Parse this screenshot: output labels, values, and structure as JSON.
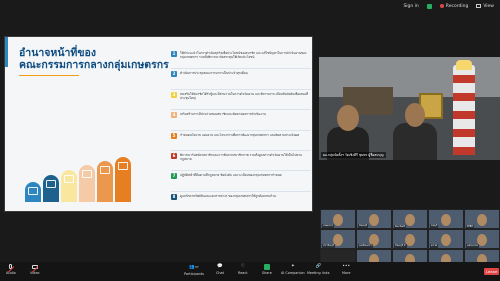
{
  "topbar": {
    "signin": "Sign in",
    "recording": "Recording",
    "view": "View"
  },
  "slide": {
    "title": "อำนาจหน้าที่ของ\nคณะกรรมการกลางกลุ่มเกษตรกร",
    "items": [
      {
        "num": "1",
        "color": "#2e86c1",
        "text": "ให้คำแนะนำในการดำเนินธุรกิจเพื่อประโยชน์ของสมาชิก และแก้ไขปัญหาในการดำเนินงานของกลุ่มเกษตรกร รวมทั้งพิจารณาจัดสรรทุนให้เกิดประโยชน์"
      },
      {
        "num": "2",
        "color": "#2e86c1",
        "text": "ดำเนินการประชุมคณะกรรมการเป็นประจำทุกเดือน"
      },
      {
        "num": "3",
        "color": "#f4d03f",
        "text": "ส่งเสริมให้สมาชิกได้รับรู้และมีส่วนร่วมในการดำเนินงาน และพิจารณาระเบียบข้อบังคับเพื่อเสนอที่ประชุมใหญ่"
      },
      {
        "num": "4",
        "color": "#f0b27a",
        "text": "เสริมสร้างการมีส่วนร่วมของสมาชิกและติดตามผลการดำเนินงาน"
      },
      {
        "num": "5",
        "color": "#e67e22",
        "text": "กำหนดนโยบาย แผนงาน และโครงการเพื่อการพัฒนากลุ่มเกษตรกร และติดตามประเมินผล"
      },
      {
        "num": "6",
        "color": "#c0392b",
        "text": "พิจารณารับสมัครสมาชิกและการพ้นจากสมาชิกภาพ รวมทั้งดูแลการดำเนินงานให้เป็นไปตามกฎหมาย"
      },
      {
        "num": "7",
        "color": "#239b56",
        "text": "ปฏิบัติหน้าที่อื่นตามที่กฎหมาย ข้อบังคับ และระเบียบของกลุ่มเกษตรกรกำหนด"
      },
      {
        "num": "8",
        "color": "#1a5276",
        "text": "ดูแลรักษาทรัพย์สินและเอกสารต่างๆ ของกลุ่มเกษตรกรให้ถูกต้องครบถ้วน"
      }
    ],
    "bar_colors": [
      "#2e86c1",
      "#1f618d",
      "#f9e79f",
      "#f5cba7",
      "#eb984e",
      "#e67e22"
    ],
    "bar_levels": [
      0.45,
      0.6,
      0.72,
      0.82,
      0.92,
      1.0
    ]
  },
  "speaker": {
    "name": "ผอ.กลุ่มจัดตั้งฯ วัดเชิงคีรี ชุมพร ผู้ชื่อสมบุญ"
  },
  "gallery": {
    "label": "1 of 2",
    "tiles": [
      {
        "name": "เกษตรกร",
        "dark": false
      },
      {
        "name": "จันทบุรี",
        "dark": false
      },
      {
        "name": "Suchart",
        "dark": false
      },
      {
        "name": "ชลบุรี",
        "dark": false
      },
      {
        "name": "PHM",
        "dark": false
      },
      {
        "name": "ปราจีนบุรี",
        "dark": false
      },
      {
        "name": "ฉะเชิงเทรา",
        "dark": false
      },
      {
        "name": "จันทบุรี 2",
        "dark": false
      },
      {
        "name": "ตราด",
        "dark": false
      },
      {
        "name": "นครนายก",
        "dark": false
      },
      {
        "name": "ระยอง",
        "dark": true
      },
      {
        "name": "สระแก้ว",
        "dark": false
      },
      {
        "name": "สหกรณ์",
        "dark": false
      },
      {
        "name": "ตอนชื่อ",
        "dark": false
      },
      {
        "name": "อื่นๆ",
        "dark": false
      }
    ]
  },
  "toolbar": {
    "audio": "Audio",
    "video": "Video",
    "participants": "Participants",
    "participants_count": "37",
    "chat": "Chat",
    "react": "React",
    "share": "Share",
    "ai_companion": "AI Companion",
    "meeting_links": "Meeting links",
    "more": "More",
    "leave": "Leave"
  }
}
